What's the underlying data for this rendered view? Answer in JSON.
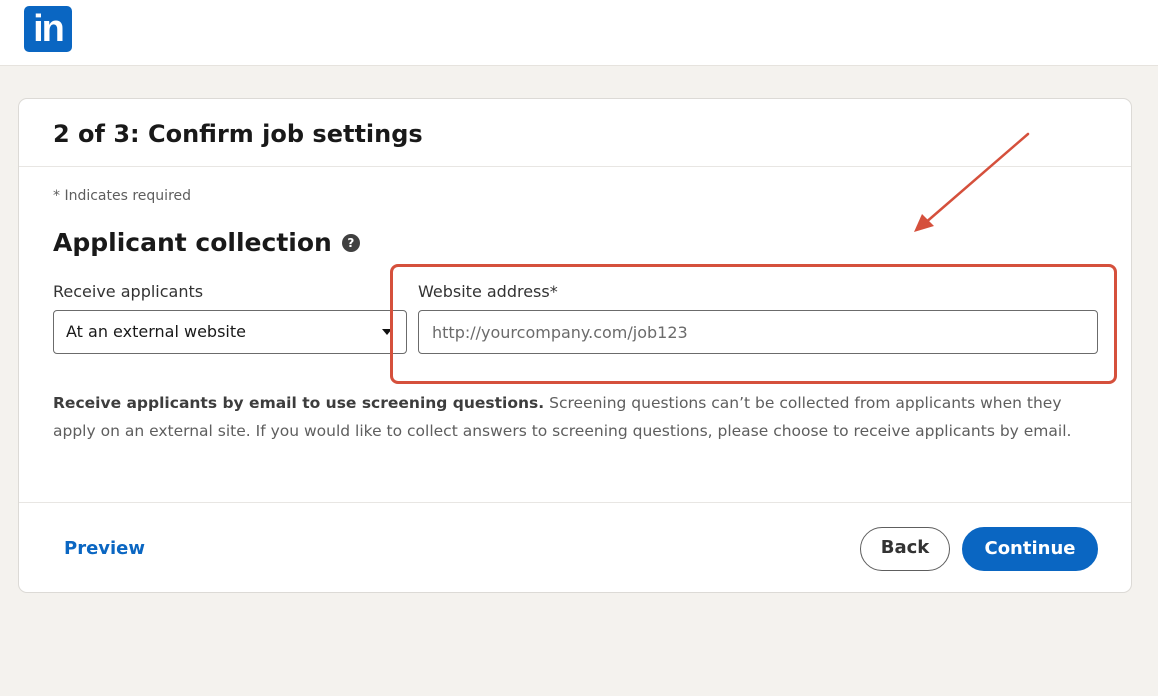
{
  "header": {
    "logo_text": "in"
  },
  "card": {
    "title": "2 of 3: Confirm job settings",
    "required_note": "* Indicates required",
    "section_title": "Applicant collection",
    "help_icon_glyph": "?",
    "receive": {
      "label": "Receive applicants",
      "value": "At an external website"
    },
    "website": {
      "label": "Website address*",
      "value": "",
      "placeholder": "http://yourcompany.com/job123"
    },
    "info": {
      "bold": "Receive applicants by email to use screening questions.",
      "rest": " Screening questions can’t be collected from applicants when they apply on an external site. If you would like to collect answers to screening questions, please choose to receive applicants by email."
    }
  },
  "footer": {
    "preview_label": "Preview",
    "back_label": "Back",
    "continue_label": "Continue"
  },
  "colors": {
    "brand": "#0a66c2",
    "annotation": "#d5503c",
    "background": "#f4f2ee"
  },
  "icons": [
    "linkedin-logo",
    "help-icon",
    "caret-down-icon",
    "annotation-arrow"
  ]
}
